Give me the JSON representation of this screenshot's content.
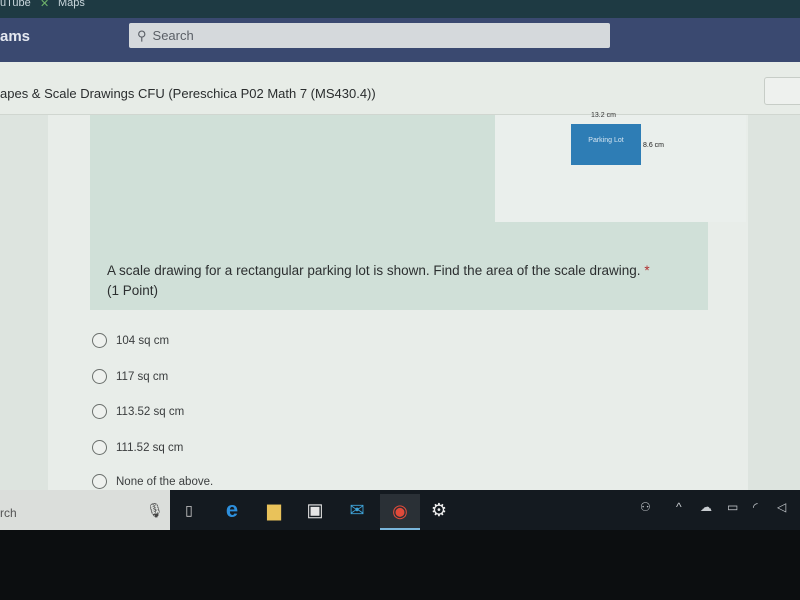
{
  "bookmarks": [
    {
      "label": "uTube"
    },
    {
      "label": "Maps"
    }
  ],
  "header": {
    "app_name": "ams",
    "search_placeholder": "Search"
  },
  "form_title": "apes & Scale Drawings CFU (Pereschica P02 Math 7 (MS430.4))",
  "figure": {
    "shape_label": "Parking Lot",
    "width_label": "13.2 cm",
    "height_label": "8.6 cm",
    "fill": "#2e7db5"
  },
  "question": {
    "text": "A scale drawing for a rectangular parking lot is shown. Find the area of the scale drawing.",
    "required": "*",
    "points": "(1 Point)"
  },
  "options": [
    {
      "label": "104 sq cm"
    },
    {
      "label": "117 sq cm"
    },
    {
      "label": "113.52 sq cm"
    },
    {
      "label": "111.52 sq cm"
    },
    {
      "label": "None of the above."
    }
  ],
  "taskbar": {
    "search_text": "rch",
    "apps": [
      "task-view",
      "edge",
      "file-explorer",
      "store",
      "mail",
      "chrome",
      "settings"
    ]
  }
}
